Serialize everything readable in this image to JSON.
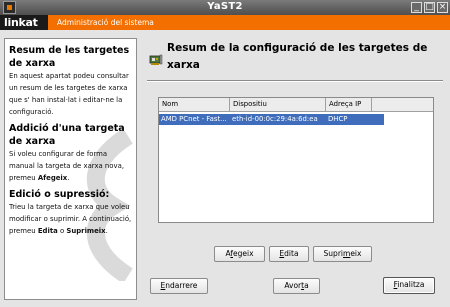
{
  "window": {
    "title": "YaST2",
    "controls": [
      "_",
      "□",
      "×"
    ]
  },
  "brand": {
    "logo_prefix": "linkat",
    "section": "Administració del sistema"
  },
  "help": {
    "sections": [
      {
        "title": "Resum de les targetes de xarxa",
        "text": "En aquest apartat podeu consultar un resum de les targetes de xarxa que s' han instal·lat i editar-ne la configuració."
      },
      {
        "title": "Addició d'una targeta de xarxa",
        "text_before": "Si voleu configurar de forma manual la targeta de xarxa nova, premeu ",
        "text_bold": "Afegeix",
        "text_after": "."
      },
      {
        "title": "Edició o supressió:",
        "text_before": "Trieu la targeta de xarxa que voleu modificar o suprimir. A continuació, premeu ",
        "text_bold1": "Edita",
        "text_mid": " o ",
        "text_bold2": "Suprimeix",
        "text_after": "."
      }
    ]
  },
  "main": {
    "heading": "Resum de la configuració de les targetes de xarxa",
    "table": {
      "columns": [
        "Nom",
        "Dispositiu",
        "Adreça IP"
      ],
      "rows": [
        [
          "AMD PCnet - Fast...",
          "eth-id-00:0c:29:4a:6d:ea",
          "DHCP"
        ]
      ]
    },
    "buttons": {
      "add": {
        "pre": "A",
        "key": "f",
        "post": "egeix"
      },
      "edit": {
        "pre": "",
        "key": "E",
        "post": "dita"
      },
      "delete": {
        "pre": "Supri",
        "key": "m",
        "post": "eix"
      }
    }
  },
  "footer": {
    "back": {
      "pre": "",
      "key": "E",
      "post": "ndarrere"
    },
    "abort": {
      "pre": "Avor",
      "key": "t",
      "post": "a"
    },
    "finish": {
      "pre": "",
      "key": "F",
      "post": "inalitza"
    }
  },
  "colors": {
    "brand_orange": "#f26f00",
    "selection_blue": "#3f6dbc"
  }
}
